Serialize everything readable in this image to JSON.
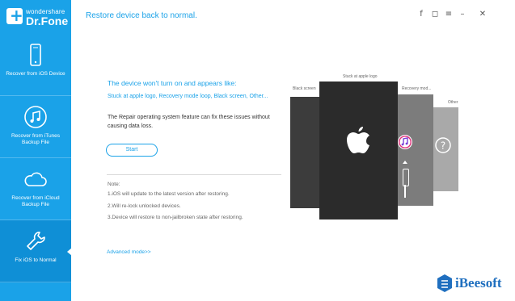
{
  "app": {
    "logo_small": "wondershare",
    "logo_big": "Dr.Fone",
    "title": "Restore device back to normal."
  },
  "window_controls": [
    {
      "name": "facebook-icon",
      "glyph": "f"
    },
    {
      "name": "feedback-icon",
      "glyph": "◻"
    },
    {
      "name": "menu-icon",
      "glyph": "≡"
    },
    {
      "name": "minimize-icon",
      "glyph": "–"
    },
    {
      "name": "close-icon",
      "glyph": "✕"
    }
  ],
  "sidebar": {
    "items": [
      {
        "label": "Recover from iOS Device",
        "icon": "phone-icon",
        "active": false
      },
      {
        "label": "Recover from iTunes Backup File",
        "icon": "music-note-icon",
        "active": false
      },
      {
        "label": "Recover from iCloud Backup File",
        "icon": "cloud-icon",
        "active": false
      },
      {
        "label": "Fix iOS to Normal",
        "icon": "wrench-icon",
        "active": true
      }
    ]
  },
  "main": {
    "heading": "The device won't turn on and appears like:",
    "subheading": "Stuck at apple logo, Recovery mode loop, Black screen, Other...",
    "description": "The Repair operating system feature can fix these issues without causing data loss.",
    "start_label": "Start",
    "note_title": "Note:",
    "notes": [
      "1.iOS will update to the latest version after restoring.",
      "2.Will re-lock unlocked devices.",
      "3.Device will restore to non-jailbroken state after restoring."
    ],
    "advanced_label": "Advanced mode>>"
  },
  "illustration": {
    "labels": {
      "black_screen": "Black screen",
      "apple_logo": "Stuck at apple logo",
      "recovery": "Recovery mod...",
      "other": "Other"
    }
  },
  "watermark": {
    "text": "iBeesoft"
  },
  "colors": {
    "accent": "#1aa2e8",
    "sidebar_active": "#0f8fd6",
    "phone_dark": "#2b2b2b",
    "phone_gray": "#6f6f6f"
  }
}
